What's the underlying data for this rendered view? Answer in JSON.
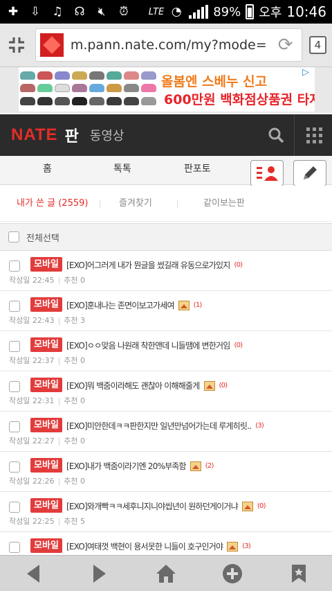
{
  "status_bar": {
    "battery": "89%",
    "network": "LTE",
    "ampm": "오후",
    "time": "10:46"
  },
  "browser": {
    "url": "m.pann.nate.com/my?mode=",
    "tab_count": "4"
  },
  "ad": {
    "line1": "올봄엔 스베누 신고",
    "line2": "600만원 백화점상품권 타자!"
  },
  "header": {
    "logo": "NATE",
    "section": "판",
    "video": "동영상"
  },
  "nav": {
    "home": "홈",
    "talk": "톡톡",
    "photo": "판포토"
  },
  "subtabs": {
    "my_posts": "내가 쓴 글 (2559)",
    "favorites": "즐겨찾기",
    "shared": "같이보는판"
  },
  "select_all_label": "전체선택",
  "badge_label": "모바일",
  "posts": [
    {
      "title": "[EXO]어그러게 내가 뭔글을 썼길래 유동으로가있지",
      "count": "(0)",
      "has_image": false,
      "meta_date": "작성일 22:45",
      "meta_rec": "추천 0"
    },
    {
      "title": "[EXO]훈내나는 존면이보고가세여",
      "count": "(1)",
      "has_image": true,
      "meta_date": "작성일 22:43",
      "meta_rec": "추천 3"
    },
    {
      "title": "[EXO]ㅇㅇ맞음 나원래 착한앤데 니들땜에 변한거임",
      "count": "(0)",
      "has_image": false,
      "meta_date": "작성일 22:37",
      "meta_rec": "추천 0"
    },
    {
      "title": "[EXO]뭐 백줌이라해도 괜찮아 이해해줄게",
      "count": "(0)",
      "has_image": true,
      "meta_date": "작성일 22:31",
      "meta_rec": "추천 0"
    },
    {
      "title": "[EXO]미안한데ㅋㅋ판한지만 일년만넘어가는데 루게히릿..",
      "count": "(3)",
      "has_image": false,
      "meta_date": "작성일 22:27",
      "meta_rec": "추천 0"
    },
    {
      "title": "[EXO]내가 백줌이라기엔 20%부족함",
      "count": "(2)",
      "has_image": true,
      "meta_date": "작성일 22:26",
      "meta_rec": "추천 0"
    },
    {
      "title": "[EXO]와개빡ㅋㅋ세후니지니야씹년이 원하던게이거냐",
      "count": "(0)",
      "has_image": true,
      "meta_date": "작성일 22:25",
      "meta_rec": "추천 5"
    },
    {
      "title": "[EXO]여태껏 백현이 용서못한 니들이 호구인거야",
      "count": "(3)",
      "has_image": true,
      "meta_date": "",
      "meta_rec": ""
    }
  ],
  "colors": {
    "accent": "#e52d27",
    "header_bg": "#2b2b2b"
  }
}
